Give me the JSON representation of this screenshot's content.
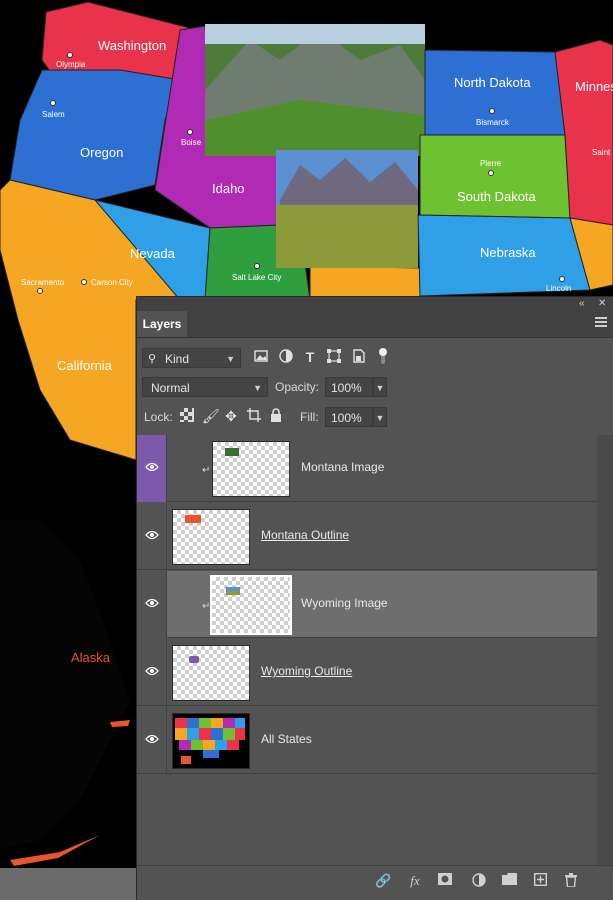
{
  "map": {
    "states": [
      {
        "name": "Washington",
        "color": "#e8334a"
      },
      {
        "name": "Oregon",
        "color": "#2e6fd4"
      },
      {
        "name": "Idaho",
        "color": "#b02ab3"
      },
      {
        "name": "Nevada",
        "color": "#2fa0e8"
      },
      {
        "name": "California",
        "color": "#f5a623"
      },
      {
        "name": "North Dakota",
        "color": "#2e6fd4"
      },
      {
        "name": "South Dakota",
        "color": "#6ec232"
      },
      {
        "name": "Nebraska",
        "color": "#2fa0e8"
      },
      {
        "name": "Minnes",
        "color": "#e8334a"
      }
    ],
    "cities": [
      "Olympia",
      "Salem",
      "Boise",
      "Sacramento",
      "Carson City",
      "Salt Lake City",
      "Bismarck",
      "Pierre",
      "Lincoln",
      "Saint"
    ],
    "alaska_label": "Alaska",
    "alaska_color": "#e8542c"
  },
  "panel": {
    "collapse_icon": "double-chevron-icon",
    "close_icon": "close-icon",
    "tab_label": "Layers",
    "filter": {
      "value": "Kind",
      "icon": "search-icon"
    },
    "filter_icons": [
      "image-filter-icon",
      "adjustment-filter-icon",
      "type-filter-icon",
      "shape-filter-icon",
      "smart-object-filter-icon",
      "toggle-filter-icon"
    ],
    "blend_mode": "Normal",
    "opacity_label": "Opacity:",
    "opacity_value": "100%",
    "lock_label": "Lock:",
    "fill_label": "Fill:",
    "fill_value": "100%",
    "layers": [
      {
        "name": "Montana Image",
        "clipped": true,
        "selected": false
      },
      {
        "name": "Montana Outline",
        "clipped": false,
        "selected": false
      },
      {
        "name": "Wyoming Image",
        "clipped": true,
        "selected": true
      },
      {
        "name": "Wyoming Outline",
        "clipped": false,
        "selected": false
      },
      {
        "name": "All States",
        "clipped": false,
        "selected": false
      }
    ],
    "bottom_icons": [
      "link-icon",
      "fx-icon",
      "mask-icon",
      "adjustment-icon",
      "folder-icon",
      "new-layer-icon",
      "trash-icon"
    ],
    "accent_color": "#7b5aab"
  }
}
